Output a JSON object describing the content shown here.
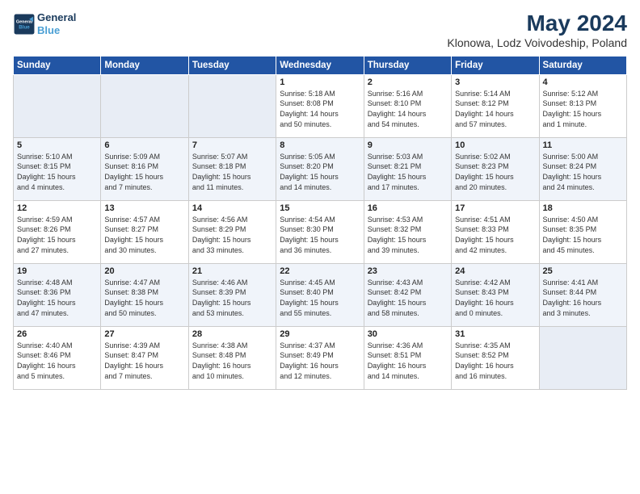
{
  "header": {
    "logo_line1": "General",
    "logo_line2": "Blue",
    "title": "May 2024",
    "subtitle": "Klonowa, Lodz Voivodeship, Poland"
  },
  "days_of_week": [
    "Sunday",
    "Monday",
    "Tuesday",
    "Wednesday",
    "Thursday",
    "Friday",
    "Saturday"
  ],
  "weeks": [
    [
      {
        "day": "",
        "info": ""
      },
      {
        "day": "",
        "info": ""
      },
      {
        "day": "",
        "info": ""
      },
      {
        "day": "1",
        "info": "Sunrise: 5:18 AM\nSunset: 8:08 PM\nDaylight: 14 hours\nand 50 minutes."
      },
      {
        "day": "2",
        "info": "Sunrise: 5:16 AM\nSunset: 8:10 PM\nDaylight: 14 hours\nand 54 minutes."
      },
      {
        "day": "3",
        "info": "Sunrise: 5:14 AM\nSunset: 8:12 PM\nDaylight: 14 hours\nand 57 minutes."
      },
      {
        "day": "4",
        "info": "Sunrise: 5:12 AM\nSunset: 8:13 PM\nDaylight: 15 hours\nand 1 minute."
      }
    ],
    [
      {
        "day": "5",
        "info": "Sunrise: 5:10 AM\nSunset: 8:15 PM\nDaylight: 15 hours\nand 4 minutes."
      },
      {
        "day": "6",
        "info": "Sunrise: 5:09 AM\nSunset: 8:16 PM\nDaylight: 15 hours\nand 7 minutes."
      },
      {
        "day": "7",
        "info": "Sunrise: 5:07 AM\nSunset: 8:18 PM\nDaylight: 15 hours\nand 11 minutes."
      },
      {
        "day": "8",
        "info": "Sunrise: 5:05 AM\nSunset: 8:20 PM\nDaylight: 15 hours\nand 14 minutes."
      },
      {
        "day": "9",
        "info": "Sunrise: 5:03 AM\nSunset: 8:21 PM\nDaylight: 15 hours\nand 17 minutes."
      },
      {
        "day": "10",
        "info": "Sunrise: 5:02 AM\nSunset: 8:23 PM\nDaylight: 15 hours\nand 20 minutes."
      },
      {
        "day": "11",
        "info": "Sunrise: 5:00 AM\nSunset: 8:24 PM\nDaylight: 15 hours\nand 24 minutes."
      }
    ],
    [
      {
        "day": "12",
        "info": "Sunrise: 4:59 AM\nSunset: 8:26 PM\nDaylight: 15 hours\nand 27 minutes."
      },
      {
        "day": "13",
        "info": "Sunrise: 4:57 AM\nSunset: 8:27 PM\nDaylight: 15 hours\nand 30 minutes."
      },
      {
        "day": "14",
        "info": "Sunrise: 4:56 AM\nSunset: 8:29 PM\nDaylight: 15 hours\nand 33 minutes."
      },
      {
        "day": "15",
        "info": "Sunrise: 4:54 AM\nSunset: 8:30 PM\nDaylight: 15 hours\nand 36 minutes."
      },
      {
        "day": "16",
        "info": "Sunrise: 4:53 AM\nSunset: 8:32 PM\nDaylight: 15 hours\nand 39 minutes."
      },
      {
        "day": "17",
        "info": "Sunrise: 4:51 AM\nSunset: 8:33 PM\nDaylight: 15 hours\nand 42 minutes."
      },
      {
        "day": "18",
        "info": "Sunrise: 4:50 AM\nSunset: 8:35 PM\nDaylight: 15 hours\nand 45 minutes."
      }
    ],
    [
      {
        "day": "19",
        "info": "Sunrise: 4:48 AM\nSunset: 8:36 PM\nDaylight: 15 hours\nand 47 minutes."
      },
      {
        "day": "20",
        "info": "Sunrise: 4:47 AM\nSunset: 8:38 PM\nDaylight: 15 hours\nand 50 minutes."
      },
      {
        "day": "21",
        "info": "Sunrise: 4:46 AM\nSunset: 8:39 PM\nDaylight: 15 hours\nand 53 minutes."
      },
      {
        "day": "22",
        "info": "Sunrise: 4:45 AM\nSunset: 8:40 PM\nDaylight: 15 hours\nand 55 minutes."
      },
      {
        "day": "23",
        "info": "Sunrise: 4:43 AM\nSunset: 8:42 PM\nDaylight: 15 hours\nand 58 minutes."
      },
      {
        "day": "24",
        "info": "Sunrise: 4:42 AM\nSunset: 8:43 PM\nDaylight: 16 hours\nand 0 minutes."
      },
      {
        "day": "25",
        "info": "Sunrise: 4:41 AM\nSunset: 8:44 PM\nDaylight: 16 hours\nand 3 minutes."
      }
    ],
    [
      {
        "day": "26",
        "info": "Sunrise: 4:40 AM\nSunset: 8:46 PM\nDaylight: 16 hours\nand 5 minutes."
      },
      {
        "day": "27",
        "info": "Sunrise: 4:39 AM\nSunset: 8:47 PM\nDaylight: 16 hours\nand 7 minutes."
      },
      {
        "day": "28",
        "info": "Sunrise: 4:38 AM\nSunset: 8:48 PM\nDaylight: 16 hours\nand 10 minutes."
      },
      {
        "day": "29",
        "info": "Sunrise: 4:37 AM\nSunset: 8:49 PM\nDaylight: 16 hours\nand 12 minutes."
      },
      {
        "day": "30",
        "info": "Sunrise: 4:36 AM\nSunset: 8:51 PM\nDaylight: 16 hours\nand 14 minutes."
      },
      {
        "day": "31",
        "info": "Sunrise: 4:35 AM\nSunset: 8:52 PM\nDaylight: 16 hours\nand 16 minutes."
      },
      {
        "day": "",
        "info": ""
      }
    ]
  ]
}
